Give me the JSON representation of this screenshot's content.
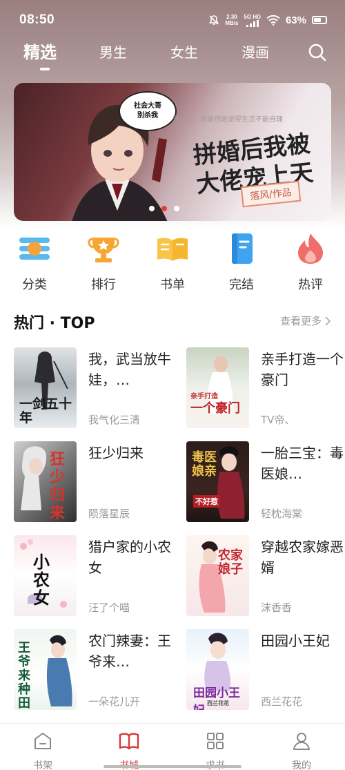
{
  "status_bar": {
    "time": "08:50",
    "net_speed_value": "2.30",
    "net_speed_unit": "MB/s",
    "network_label": "5G HD",
    "battery": "63%",
    "battery_level": 0.63
  },
  "nav": {
    "tabs": [
      {
        "label": "精选",
        "active": true
      },
      {
        "label": "男生",
        "active": false
      },
      {
        "label": "女生",
        "active": false
      },
      {
        "label": "漫画",
        "active": false
      }
    ],
    "search_icon": "search-icon"
  },
  "banner": {
    "speech_bubble": [
      "社会大哥",
      "别杀我"
    ],
    "tagline": "宠女人，就要把她宠得生活不能自理",
    "title_line1": "拼婚后我被",
    "title_line2": "大佬宠上天",
    "author": "落风/作品",
    "pages": 3,
    "active_page": 2
  },
  "categories": [
    {
      "label": "分类",
      "icon": "category-icon"
    },
    {
      "label": "排行",
      "icon": "trophy-icon"
    },
    {
      "label": "书单",
      "icon": "open-book-icon"
    },
    {
      "label": "完结",
      "icon": "finished-book-icon"
    },
    {
      "label": "热评",
      "icon": "flame-icon"
    }
  ],
  "section": {
    "title": "热门 · TOP",
    "more": "查看更多"
  },
  "books": [
    {
      "title": "我，武当放牛娃，…",
      "author": "我气化三清",
      "cover_text": "一剑五十年",
      "cover_sub": "我气化三清"
    },
    {
      "title": "亲手打造一个豪门",
      "author": "TV帝、",
      "cover_text": "一个豪门",
      "cover_sub": "亲手打造"
    },
    {
      "title": "狂少归来",
      "author": "陨落星辰",
      "cover_text": "狂少归来",
      "cover_sub": ""
    },
    {
      "title": "一胎三宝：毒医娘…",
      "author": "轻枕海棠",
      "cover_text": "毒医娘亲",
      "cover_sub": "不好惹"
    },
    {
      "title": "猎户家的小农女",
      "author": "汪了个喵",
      "cover_text": "小农女",
      "cover_sub": ""
    },
    {
      "title": "穿越农家嫁恶婿",
      "author": "沫香香",
      "cover_text": "农家娘子",
      "cover_sub": ""
    },
    {
      "title": "农门辣妻：王爷来…",
      "author": "一朵花儿开",
      "cover_text": "王爷来种田",
      "cover_sub": ""
    },
    {
      "title": "田园小王妃",
      "author": "西兰花花",
      "cover_text": "田园小王妃",
      "cover_sub": "西兰花花"
    }
  ],
  "bottom_nav": [
    {
      "label": "书架",
      "icon": "bookshelf-icon",
      "active": false
    },
    {
      "label": "书城",
      "icon": "bookstore-icon",
      "active": true
    },
    {
      "label": "求书",
      "icon": "request-grid-icon",
      "active": false
    },
    {
      "label": "我的",
      "icon": "profile-icon",
      "active": false
    }
  ],
  "colors": {
    "accent": "#d9383a",
    "active_dot": "#e0403c"
  }
}
